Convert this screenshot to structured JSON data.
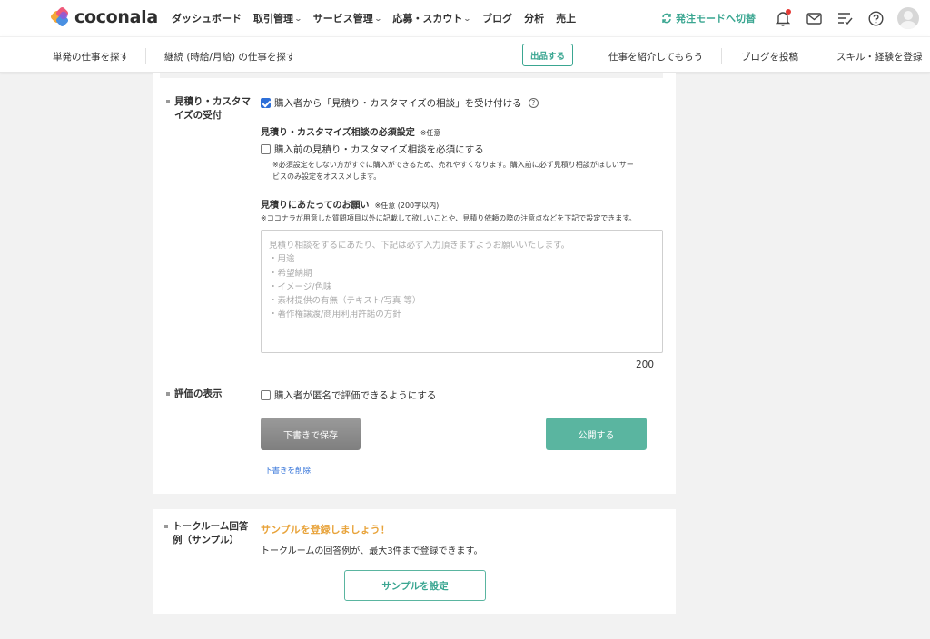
{
  "header": {
    "logo_text": "coconala",
    "nav": [
      {
        "label": "ダッシュボード",
        "has_caret": false
      },
      {
        "label": "取引管理",
        "has_caret": true
      },
      {
        "label": "サービス管理",
        "has_caret": true
      },
      {
        "label": "応募・スカウト",
        "has_caret": true
      },
      {
        "label": "ブログ",
        "has_caret": false
      },
      {
        "label": "分析",
        "has_caret": false
      },
      {
        "label": "売上",
        "has_caret": false
      }
    ],
    "mode_switch_label": "発注モードへ切替",
    "icons": [
      "bell-icon",
      "mail-icon",
      "todo-list-icon",
      "help-icon",
      "avatar"
    ],
    "accent_color": "#3aa691",
    "notification_dot_color": "#e53935"
  },
  "subnav": {
    "find_single": "単発の仕事を探す",
    "find_continuous": "継続 (時給/月給) の仕事を探す",
    "list_button": "出品する",
    "referral": "仕事を紹介してもらう",
    "post_blog": "ブログを投稿",
    "register_skills": "スキル・経験を登録"
  },
  "estimate": {
    "label_line1": "見積り・カスタマ",
    "label_line2": "イズの受付",
    "accept_checkbox": {
      "label": "購入者から「見積り・カスタマイズの相談」を受け付ける",
      "checked": true
    },
    "required_title": "見積り・カスタマイズ相談の必須設定",
    "required_tag": "※任意",
    "required_checkbox": {
      "label": "購入前の見積り・カスタマイズ相談を必須にする",
      "checked": false
    },
    "required_note_line1": "※必須設定をしない方がすぐに購入ができるため、売れやすくなります。購入前に必ず見積り相談がほしいサー",
    "required_note_line2": "ビスのみ設定をオススメします。",
    "request_title": "見積りにあたってのお願い",
    "request_tag": "※任意 (200字以内)",
    "request_note": "※ココナラが用意した質問項目以外に記載して欲しいことや、見積り依頼の際の注意点などを下記で設定できます。",
    "placeholder_lines": [
      "見積り相談をするにあたり、下記は必ず入力頂きますようお願いいたします。",
      "・用途",
      "・希望納期",
      "・イメージ/色味",
      "・素材提供の有無（テキスト/写真 等）",
      "・著作権譲渡/商用利用許諾の方針"
    ],
    "char_counter": "200"
  },
  "review": {
    "label": "評価の表示",
    "anonymous_checkbox": {
      "label": "購入者が匿名で評価できるようにする",
      "checked": false
    }
  },
  "actions": {
    "save_draft": "下書きで保存",
    "publish": "公開する",
    "delete_draft": "下書きを削除"
  },
  "talkroom": {
    "label_line1": "トークルーム回答",
    "label_line2": "例（サンプル）",
    "prompt": "サンプルを登録しましょう！",
    "description": "トークルームの回答例が、最大3件まで登録できます。",
    "set_button": "サンプルを設定"
  }
}
